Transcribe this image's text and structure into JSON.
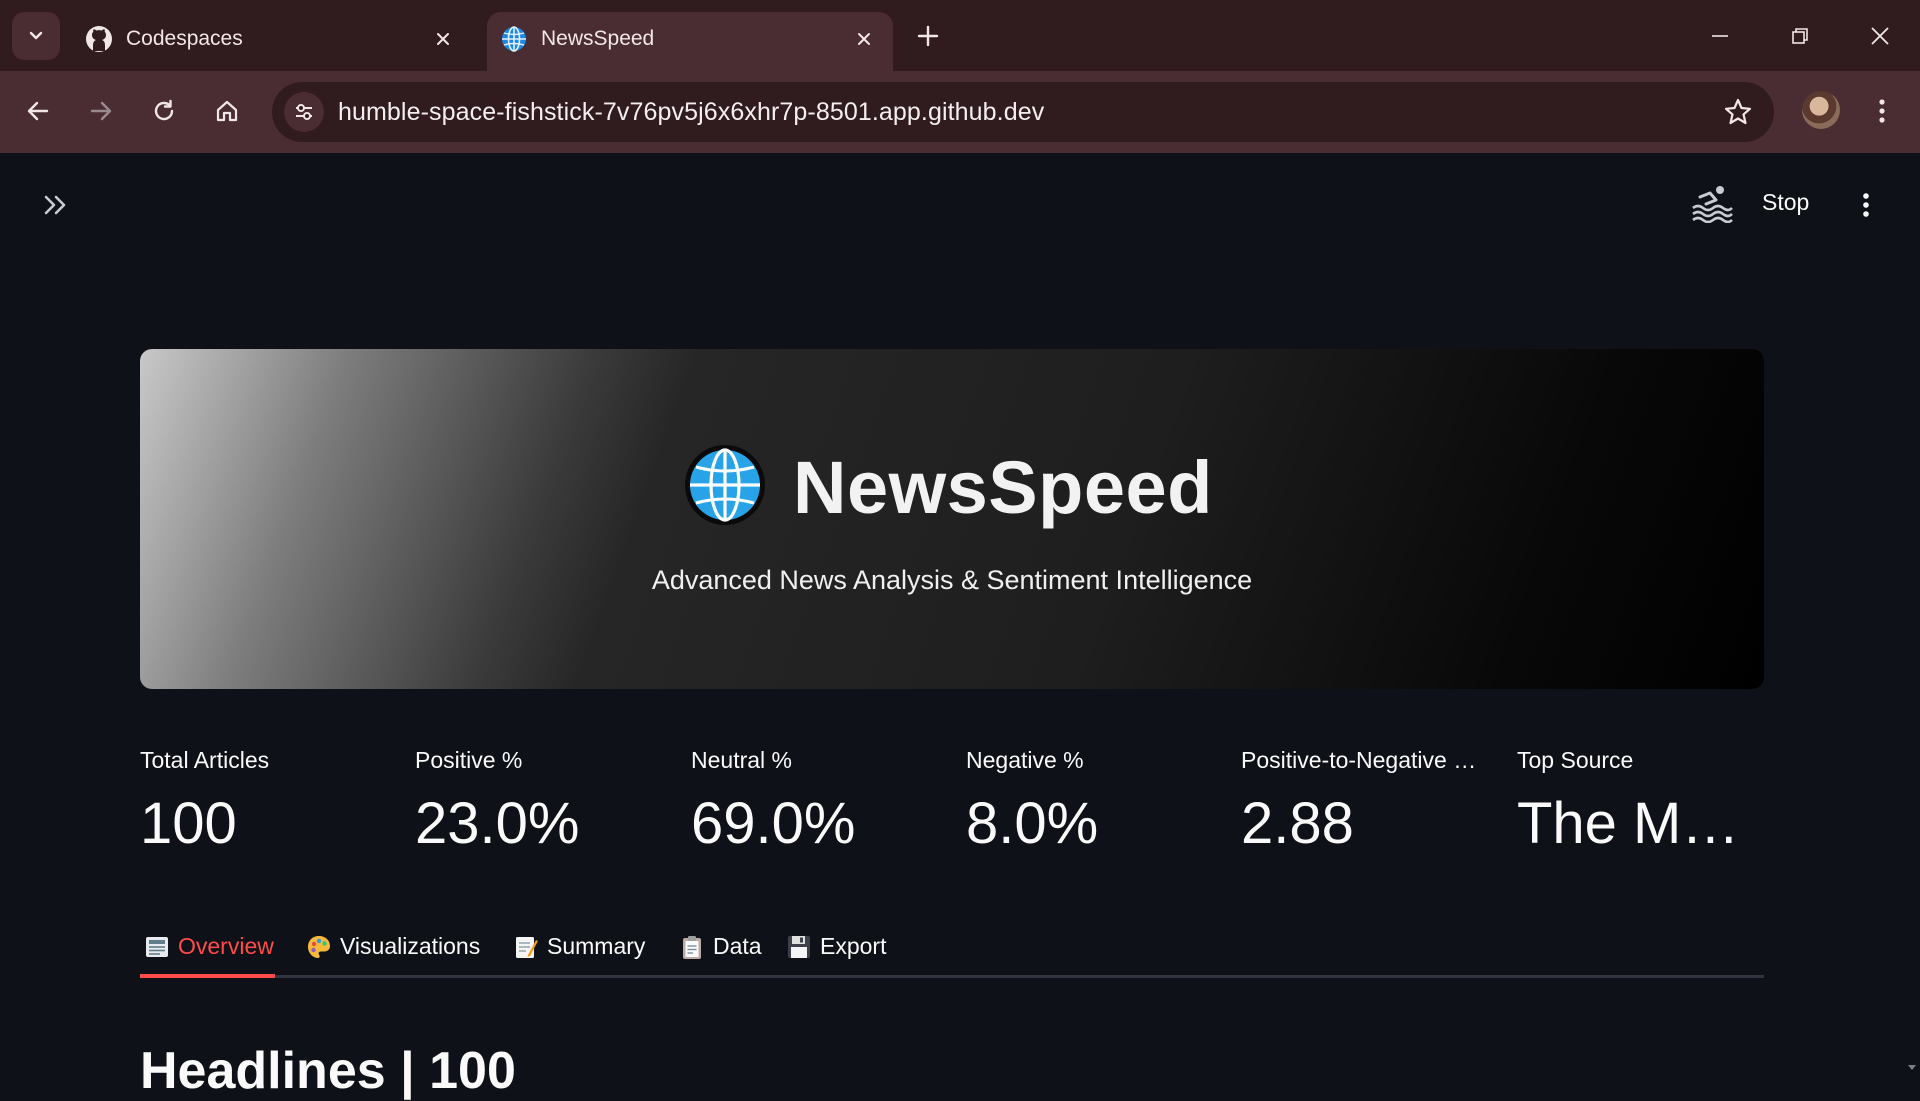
{
  "browser": {
    "tabs": [
      {
        "title": "Codespaces",
        "icon": "github-icon",
        "active": false
      },
      {
        "title": "NewsSpeed",
        "icon": "globe-icon",
        "active": true
      }
    ],
    "url": "humble-space-fishstick-7v76pv5j6x6xhr7p-8501.app.github.dev"
  },
  "app_header": {
    "stop_label": "Stop"
  },
  "hero": {
    "title": "NewsSpeed",
    "subtitle": "Advanced News Analysis & Sentiment Intelligence"
  },
  "metrics": [
    {
      "label": "Total Articles",
      "value": "100"
    },
    {
      "label": "Positive %",
      "value": "23.0%"
    },
    {
      "label": "Neutral %",
      "value": "69.0%"
    },
    {
      "label": "Negative %",
      "value": "8.0%"
    },
    {
      "label": "Positive-to-Negative Ratio",
      "value": "2.88"
    },
    {
      "label": "Top Source",
      "value": "The M…"
    }
  ],
  "tabs": [
    {
      "label": "Overview",
      "icon": "newspaper-icon",
      "selected": true
    },
    {
      "label": "Visualizations",
      "icon": "palette-icon",
      "selected": false
    },
    {
      "label": "Summary",
      "icon": "memo-icon",
      "selected": false
    },
    {
      "label": "Data",
      "icon": "clipboard-icon",
      "selected": false
    },
    {
      "label": "Export",
      "icon": "floppy-disk-icon",
      "selected": false
    }
  ],
  "section_heading": "Headlines | 100",
  "colors": {
    "accent": "#ff4b4b",
    "background": "#0e1117",
    "chrome_dark": "#301b1f",
    "chrome_light": "#4a2d33"
  }
}
